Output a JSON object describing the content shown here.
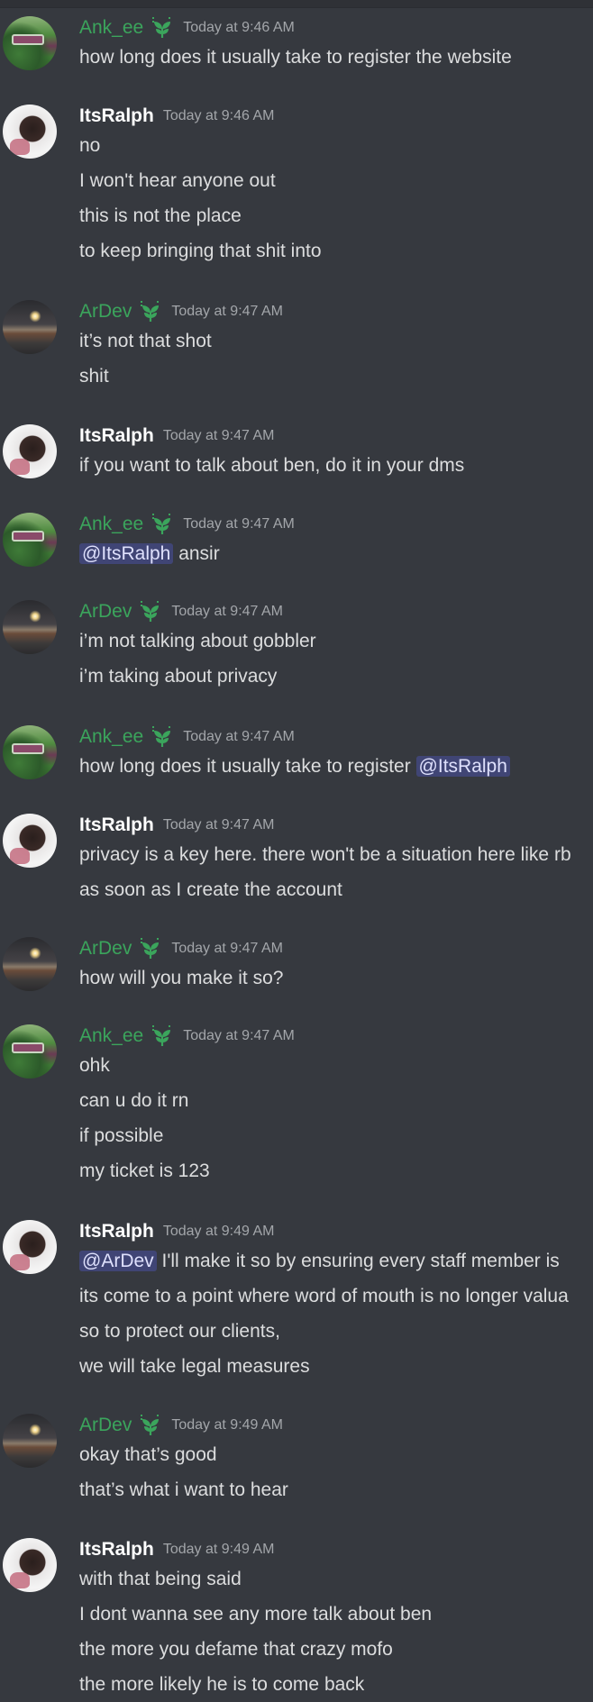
{
  "colors": {
    "background": "#36393f",
    "green_username": "#3ba55c",
    "timestamp": "#a3a6aa",
    "mention_bg": "#4e5384",
    "text": "#dcddde"
  },
  "icons": {
    "badge": "leaf-sprout-badge-icon"
  },
  "messages": [
    {
      "author": "Ank_ee",
      "timestamp": "Today at 9:46 AM",
      "lines": [
        {
          "text": "how long does it usually take to register the website"
        }
      ]
    },
    {
      "author": "ItsRalph",
      "timestamp": "Today at 9:46 AM",
      "lines": [
        {
          "text": "no"
        },
        {
          "text": "I won't hear anyone out"
        },
        {
          "text": "this is not the place"
        },
        {
          "text": "to keep bringing that shit into"
        }
      ]
    },
    {
      "author": "ArDev",
      "timestamp": "Today at 9:47 AM",
      "lines": [
        {
          "text": "it’s not that shot"
        },
        {
          "text": "shit"
        }
      ]
    },
    {
      "author": "ItsRalph",
      "timestamp": "Today at 9:47 AM",
      "lines": [
        {
          "text": "if you want to talk about ben, do it in your dms"
        }
      ]
    },
    {
      "author": "Ank_ee",
      "timestamp": "Today at 9:47 AM",
      "lines": [
        {
          "mention": "@ItsRalph",
          "text": " ansir"
        }
      ]
    },
    {
      "author": "ArDev",
      "timestamp": "Today at 9:47 AM",
      "lines": [
        {
          "text": "i’m not talking about gobbler"
        },
        {
          "text": "i’m taking about privacy"
        }
      ]
    },
    {
      "author": "Ank_ee",
      "timestamp": "Today at 9:47 AM",
      "lines": [
        {
          "text": "how long does it usually take to register ",
          "mention_after": "@ItsRalph"
        }
      ]
    },
    {
      "author": "ItsRalph",
      "timestamp": "Today at 9:47 AM",
      "lines": [
        {
          "text": "privacy is a key here. there won't be a situation here like rb"
        },
        {
          "text": "as soon as I create the account"
        }
      ]
    },
    {
      "author": "ArDev",
      "timestamp": "Today at 9:47 AM",
      "lines": [
        {
          "text": "how will you make it so?"
        }
      ]
    },
    {
      "author": "Ank_ee",
      "timestamp": "Today at 9:47 AM",
      "lines": [
        {
          "text": "ohk"
        },
        {
          "text": "can u do it rn"
        },
        {
          "text": "if possible"
        },
        {
          "text": "my ticket is 123"
        }
      ]
    },
    {
      "author": "ItsRalph",
      "timestamp": "Today at 9:49 AM",
      "lines": [
        {
          "mention": "@ArDev",
          "text": " I'll make it so by ensuring every staff member is"
        },
        {
          "text": "its come to a point where word of mouth is no longer valua"
        },
        {
          "text": "so to protect our clients,"
        },
        {
          "text": "we will take legal measures"
        }
      ]
    },
    {
      "author": "ArDev",
      "timestamp": "Today at 9:49 AM",
      "lines": [
        {
          "text": "okay that’s good"
        },
        {
          "text": "that’s what i want to hear"
        }
      ]
    },
    {
      "author": "ItsRalph",
      "timestamp": "Today at 9:49 AM",
      "lines": [
        {
          "text": "with that being said"
        },
        {
          "text": "I dont wanna see any more talk about ben"
        },
        {
          "text": "the more you defame that crazy mofo"
        },
        {
          "text": "the more likely he is to come back"
        }
      ]
    }
  ]
}
